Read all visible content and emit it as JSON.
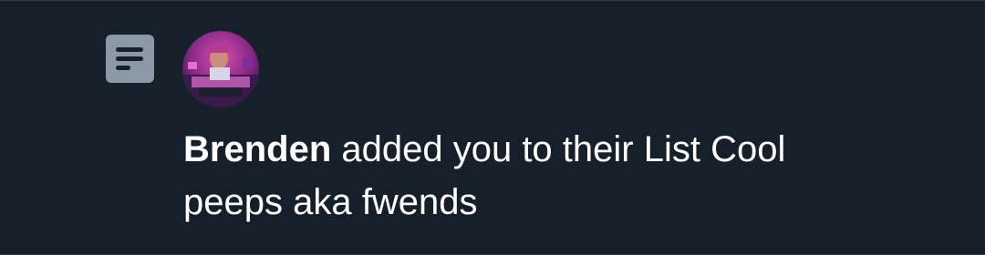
{
  "notification": {
    "type_icon": "list-icon",
    "avatar_alt": "Brenden avatar",
    "actor_name": "Brenden",
    "action_text": " added you to their List Cool peeps aka fwends",
    "colors": {
      "background": "#15202b",
      "icon_bg": "#8b98a5",
      "text": "#ffffff",
      "divider": "#2f3b47"
    }
  }
}
